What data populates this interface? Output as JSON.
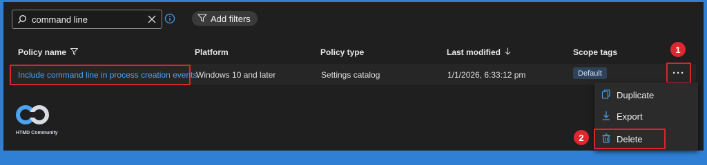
{
  "search": {
    "value": "command line"
  },
  "filters": {
    "add_label": "Add filters"
  },
  "table": {
    "columns": [
      "Policy name",
      "Platform",
      "Policy type",
      "Last modified",
      "Scope tags"
    ],
    "rows": [
      {
        "policy_name": "Include command line in process creation events",
        "platform": "Windows 10 and later",
        "policy_type": "Settings catalog",
        "last_modified": "1/1/2026, 6:33:12 pm",
        "scope_tag": "Default"
      }
    ]
  },
  "more_button": {
    "label": "···"
  },
  "context_menu": {
    "items": [
      {
        "label": "Duplicate",
        "icon": "duplicate-icon"
      },
      {
        "label": "Export",
        "icon": "download-icon"
      },
      {
        "label": "Delete",
        "icon": "trash-icon"
      }
    ]
  },
  "callouts": [
    "1",
    "2"
  ],
  "logo": {
    "text": "HTMD Community"
  },
  "colors": {
    "accent": "#4ca3f0",
    "highlight": "#d9262e",
    "frame": "#2f7fd4"
  }
}
